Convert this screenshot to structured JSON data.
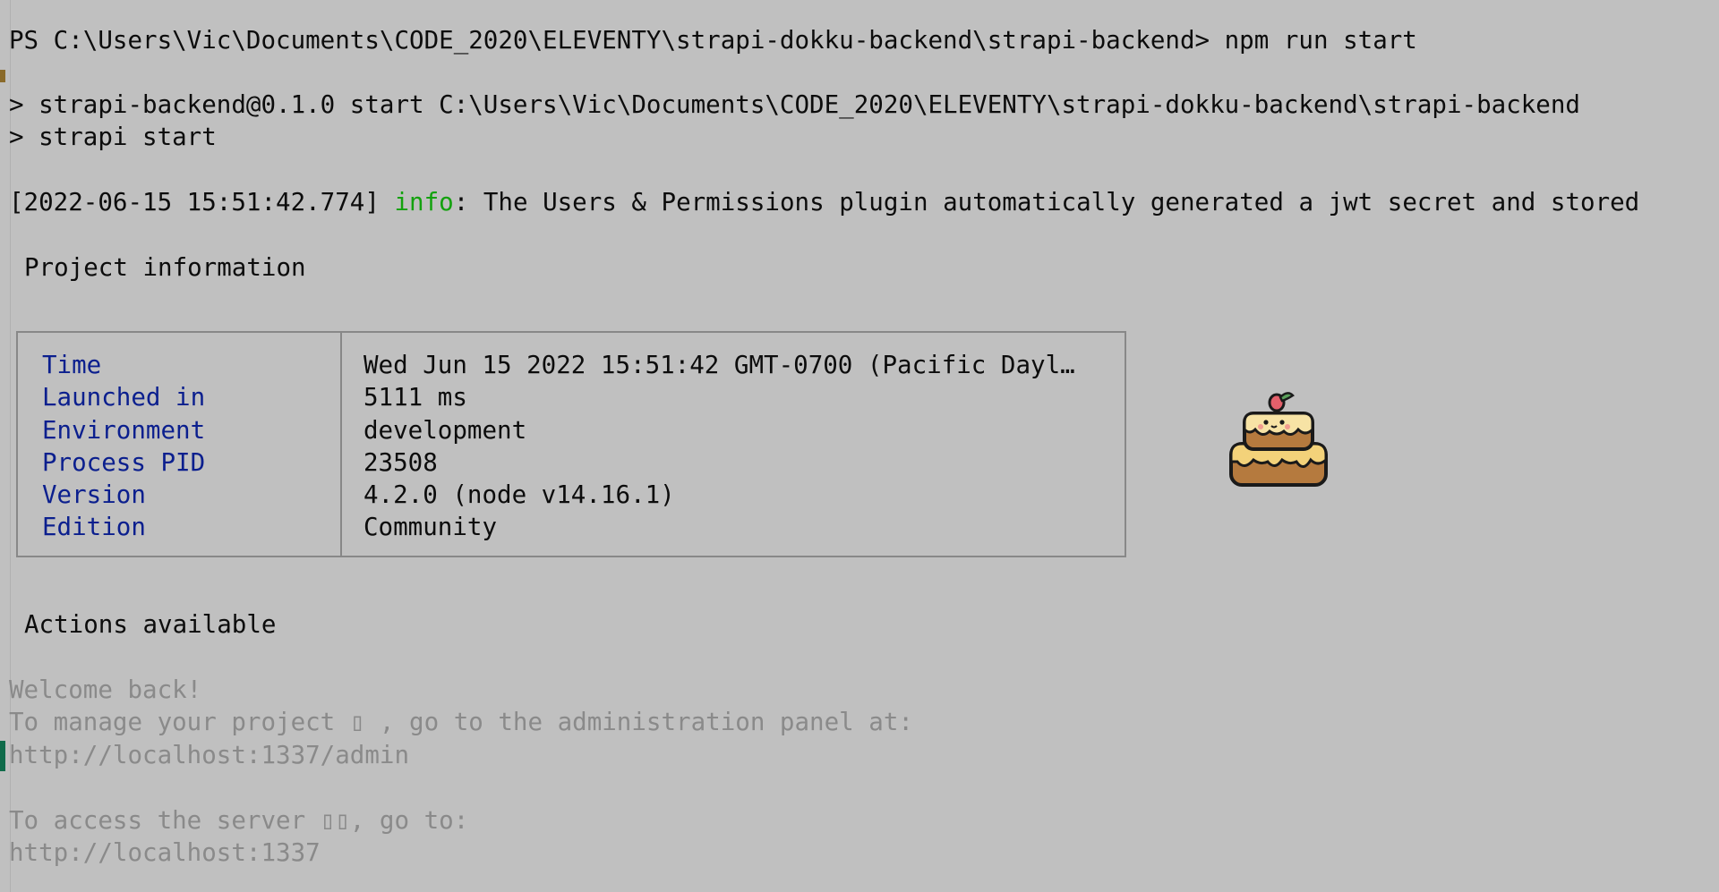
{
  "terminal": {
    "prompt_line": "PS C:\\Users\\Vic\\Documents\\CODE_2020\\ELEVENTY\\strapi-dokku-backend\\strapi-backend> npm run start",
    "npm_line_1": "> strapi-backend@0.1.0 start C:\\Users\\Vic\\Documents\\CODE_2020\\ELEVENTY\\strapi-dokku-backend\\strapi-backend",
    "npm_line_2": "> strapi start",
    "log": {
      "timestamp": "[2022-06-15 15:51:42.774]",
      "level": "info",
      "separator": ":",
      "message": " The Users & Permissions plugin automatically generated a jwt secret and stored"
    },
    "project_heading": "Project information",
    "project_info": [
      {
        "label": "Time",
        "value": "Wed Jun 15 2022 15:51:42 GMT-0700 (Pacific Dayl…"
      },
      {
        "label": "Launched in",
        "value": "5111 ms"
      },
      {
        "label": "Environment",
        "value": "development"
      },
      {
        "label": "Process PID",
        "value": "23508"
      },
      {
        "label": "Version",
        "value": "4.2.0 (node v14.16.1)"
      },
      {
        "label": "Edition",
        "value": "Community"
      }
    ],
    "actions_heading": "Actions available",
    "welcome": "Welcome back!",
    "admin_hint": "To manage your project ▯ , go to the administration panel at:",
    "admin_url": "http://localhost:1337/admin",
    "server_hint": "To access the server ▯▯, go to:",
    "server_url": "http://localhost:1337"
  },
  "mascot_icon": "strapi-cake-mascot-icon",
  "colors": {
    "background": "#c0c0c0",
    "text": "#0c0c0c",
    "info": "#13a10e",
    "table_label": "#0b1f8e",
    "dim_text": "#8a8a8a"
  }
}
